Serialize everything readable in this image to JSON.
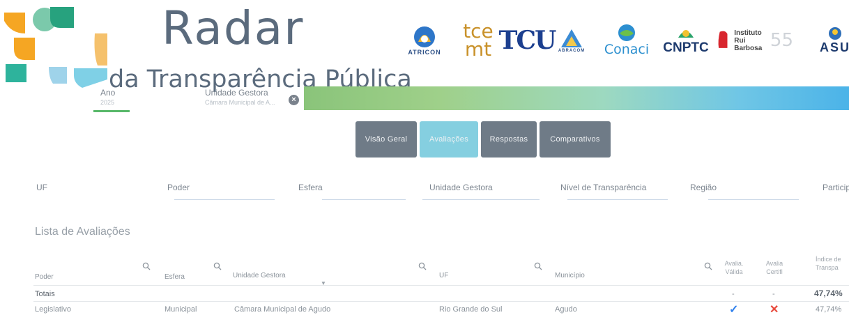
{
  "header": {
    "title": "Radar",
    "subtitle": "da Transparência Pública",
    "partners": [
      {
        "name": "ATRICON",
        "icon": "atricon-logo"
      },
      {
        "top": "tce",
        "bottom": "mt",
        "icon": "tce-mt-logo"
      },
      {
        "name": "TCU",
        "icon": "tcu-logo"
      },
      {
        "name": "ABRACOM",
        "icon": "abracom-logo"
      },
      {
        "name": "Conaci",
        "icon": "conaci-logo"
      },
      {
        "name": "CNPTC",
        "icon": "cnptc-logo"
      },
      {
        "line1": "Instituto",
        "line2": "Rui Barbosa",
        "icon": "irb-logo",
        "badge": "55"
      },
      {
        "name": "ASU",
        "icon": "asu-logo"
      }
    ]
  },
  "top_filters": {
    "ano_label": "Ano",
    "ano_value": "2025",
    "unidade_label": "Unidade Gestora",
    "unidade_value": "Câmara Municipal de A..."
  },
  "tabs": [
    {
      "label": "Visão Geral",
      "active": false
    },
    {
      "label": "Avaliações",
      "active": true
    },
    {
      "label": "Respostas",
      "active": false
    },
    {
      "label": "Comparativos",
      "active": false
    }
  ],
  "filters": [
    "UF",
    "Poder",
    "Esfera",
    "Unidade Gestora",
    "Nível de Transparência",
    "Região",
    "Particip"
  ],
  "list_title": "Lista de Avaliações",
  "table": {
    "columns": {
      "poder": "Poder",
      "esfera": "Esfera",
      "unidade": "Unidade Gestora",
      "uf": "UF",
      "municipio": "Município",
      "avalia_valida_1": "Avalia.",
      "avalia_valida_2": "Válida",
      "avalia_certifi_1": "Avalia",
      "avalia_certifi_2": "Certifi",
      "indice_1": "Índice de",
      "indice_2": "Transpa"
    },
    "totals": {
      "label": "Totais",
      "valida": "-",
      "certifi": "-",
      "indice": "47,74%"
    },
    "rows": [
      {
        "poder": "Legislativo",
        "esfera": "Municipal",
        "unidade": "Câmara Municipal de Agudo",
        "uf": "Rio Grande do Sul",
        "municipio": "Agudo",
        "valida": "✓",
        "certifi": "✕",
        "indice": "47,74%"
      }
    ]
  },
  "colors": {
    "brand_text": "#5b6b7d",
    "tab_dark": "#6f7b87",
    "tab_active": "#85cfe0",
    "check": "#2f80ed",
    "cross": "#e8483b"
  }
}
